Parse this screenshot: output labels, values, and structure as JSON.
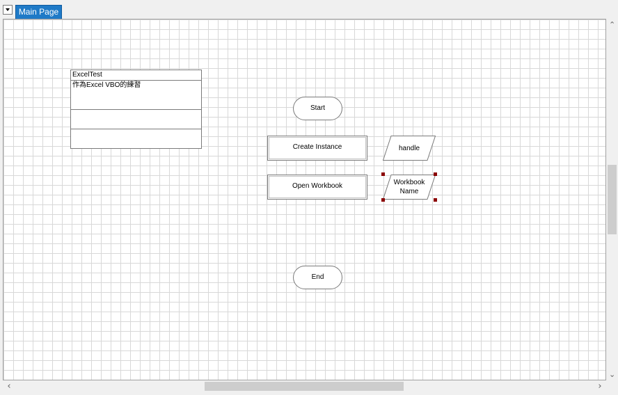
{
  "tabs": [
    {
      "label": "Main Page",
      "active": true
    }
  ],
  "info_box": {
    "title": "ExcelTest",
    "description": "作為Excel VBO的練習"
  },
  "flow": {
    "start_label": "Start",
    "end_label": "End",
    "create_instance_label": "Create Instance",
    "open_workbook_label": "Open Workbook",
    "handle_label": "handle",
    "workbook_name_label": "Workbook Name"
  },
  "colors": {
    "tab_active": "#1f7ac7",
    "selection_handle": "#8b0000",
    "grid_line": "#d8d8d8"
  }
}
